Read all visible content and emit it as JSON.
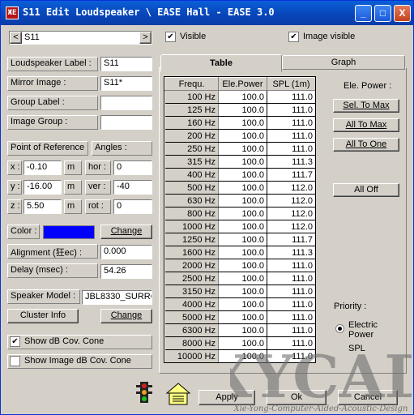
{
  "window": {
    "title": "S11 Edit Loudspeaker \\ EASE Hall - EASE 3.0",
    "app_icon_text": "ЖЕ"
  },
  "title_buttons": {
    "minimize": "_",
    "maximize": "□",
    "close": "X"
  },
  "top": {
    "prev": "<",
    "next": ">",
    "speaker_select": "S11",
    "visible_label": "Visible",
    "visible_checked": true,
    "image_visible_label": "Image visible",
    "image_visible_checked": true
  },
  "left": {
    "loudspeaker_label": "Loudspeaker Label :",
    "loudspeaker_value": "S11",
    "mirror_image_label": "Mirror Image :",
    "mirror_image_value": "S11*",
    "group_label": "Group Label :",
    "group_value": "",
    "image_group_label": "Image Group :",
    "image_group_value": "",
    "point_of_reference": "Point of Reference :",
    "angles": "Angles :",
    "x_label": "x :",
    "x_value": "-0.10",
    "x_unit": "m",
    "y_label": "y :",
    "y_value": "-16.00",
    "y_unit": "m",
    "z_label": "z :",
    "z_value": "5.50",
    "z_unit": "m",
    "hor_label": "hor :",
    "hor_value": "0",
    "ver_label": "ver :",
    "ver_value": "-40",
    "rot_label": "rot :",
    "rot_value": "0",
    "color_label": "Color :",
    "color_value": "#0000ff",
    "change_color": "Change",
    "alignment_label": "Alignment (狂ec) :",
    "alignment_value": "0.000",
    "delay_label": "Delay (msec) :",
    "delay_value": "54.26",
    "speaker_model_label": "Speaker Model :",
    "speaker_model_value": "JBL8330_SURRO",
    "cluster_info": "Cluster Info",
    "change_model": "Change",
    "show_db_cone": "Show dB Cov. Cone",
    "show_db_cone_checked": true,
    "show_image_db_cone": "Show Image dB Cov. Cone",
    "show_image_db_cone_checked": false
  },
  "tabs": {
    "table": "Table",
    "graph": "Graph"
  },
  "table": {
    "headers": [
      "Frequ.",
      "Ele.Power",
      "SPL (1m)"
    ],
    "rows": [
      [
        "100 Hz",
        "100.0",
        "111.0"
      ],
      [
        "125 Hz",
        "100.0",
        "111.0"
      ],
      [
        "160 Hz",
        "100.0",
        "111.0"
      ],
      [
        "200 Hz",
        "100.0",
        "111.0"
      ],
      [
        "250 Hz",
        "100.0",
        "111.0"
      ],
      [
        "315 Hz",
        "100.0",
        "111.3"
      ],
      [
        "400 Hz",
        "100.0",
        "111.7"
      ],
      [
        "500 Hz",
        "100.0",
        "112.0"
      ],
      [
        "630 Hz",
        "100.0",
        "112.0"
      ],
      [
        "800 Hz",
        "100.0",
        "112.0"
      ],
      [
        "1000 Hz",
        "100.0",
        "112.0"
      ],
      [
        "1250 Hz",
        "100.0",
        "111.7"
      ],
      [
        "1600 Hz",
        "100.0",
        "111.3"
      ],
      [
        "2000 Hz",
        "100.0",
        "111.0"
      ],
      [
        "2500 Hz",
        "100.0",
        "111.0"
      ],
      [
        "3150 Hz",
        "100.0",
        "111.0"
      ],
      [
        "4000 Hz",
        "100.0",
        "111.0"
      ],
      [
        "5000 Hz",
        "100.0",
        "111.0"
      ],
      [
        "6300 Hz",
        "100.0",
        "111.0"
      ],
      [
        "8000 Hz",
        "100.0",
        "111.0"
      ],
      [
        "10000 Hz",
        "100.0",
        "111.0"
      ]
    ]
  },
  "power": {
    "title": "Ele. Power :",
    "sel_to_max": "Sel. To Max",
    "all_to_max": "All To Max",
    "all_to_one": "All To One",
    "all_off": "All Off",
    "priority": "Priority :",
    "electric_power": "Electric Power",
    "spl": "SPL",
    "selected": "electric_power"
  },
  "bottom": {
    "apply": "Apply",
    "ok": "Ok",
    "cancel": "Cancel"
  },
  "watermark": {
    "logo": "XYCAD",
    "tagline": "Xie-Yong-Computer-Aided-Acoustic-Design"
  }
}
